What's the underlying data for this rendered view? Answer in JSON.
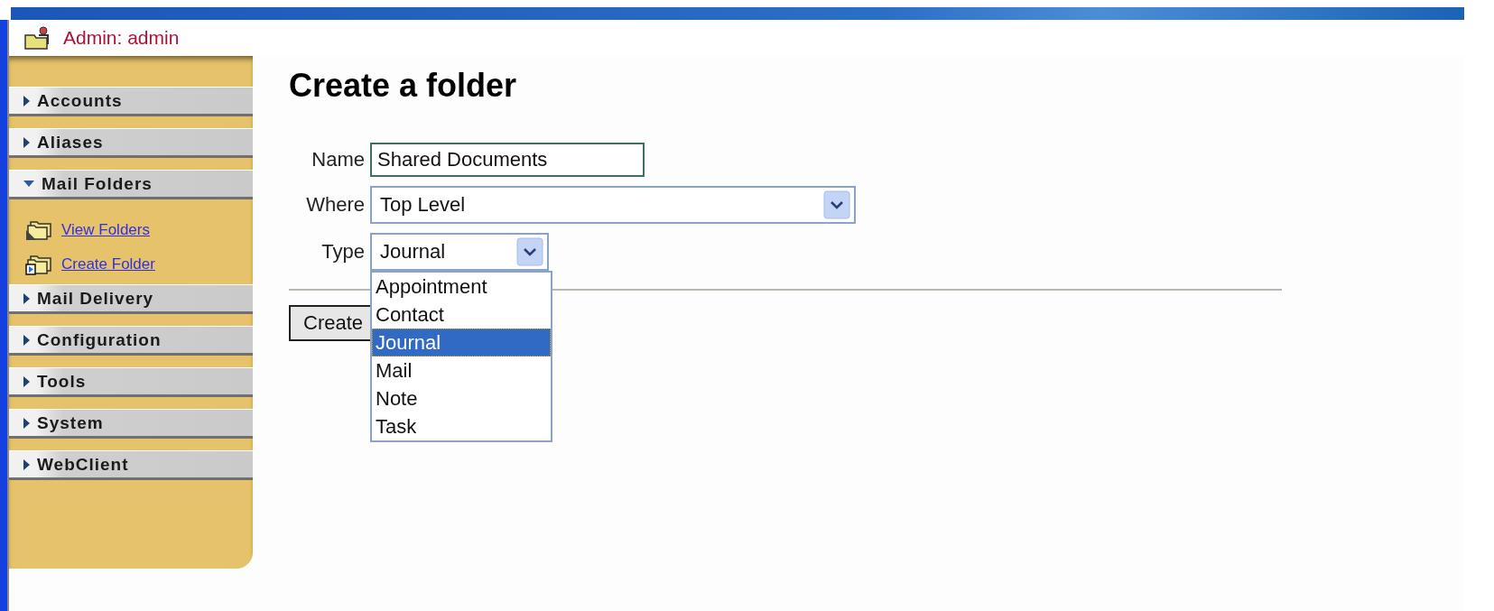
{
  "header": {
    "title": "Admin: admin"
  },
  "sidebar": {
    "sections": [
      {
        "label": "Accounts",
        "expanded": false
      },
      {
        "label": "Aliases",
        "expanded": false
      },
      {
        "label": "Mail Folders",
        "expanded": true,
        "children": [
          {
            "label": "View Folders",
            "kind": "view"
          },
          {
            "label": "Create Folder",
            "kind": "create"
          }
        ]
      },
      {
        "label": "Mail Delivery",
        "expanded": false
      },
      {
        "label": "Configuration",
        "expanded": false
      },
      {
        "label": "Tools",
        "expanded": false
      },
      {
        "label": "System",
        "expanded": false
      },
      {
        "label": "WebClient",
        "expanded": false
      }
    ]
  },
  "heading": "Create a folder",
  "form": {
    "fields": [
      {
        "label": "Name",
        "kind": "text",
        "value": "Shared Documents"
      },
      {
        "label": "Where",
        "kind": "select",
        "value": "Top Level"
      },
      {
        "label": "Type",
        "kind": "select",
        "value": "Journal",
        "open": true,
        "options": [
          {
            "label": "Appointment",
            "selected": false
          },
          {
            "label": "Contact",
            "selected": false
          },
          {
            "label": "Journal",
            "selected": true
          },
          {
            "label": "Mail",
            "selected": false
          },
          {
            "label": "Note",
            "selected": false
          },
          {
            "label": "Task",
            "selected": false
          }
        ]
      }
    ],
    "submit": "Create"
  }
}
